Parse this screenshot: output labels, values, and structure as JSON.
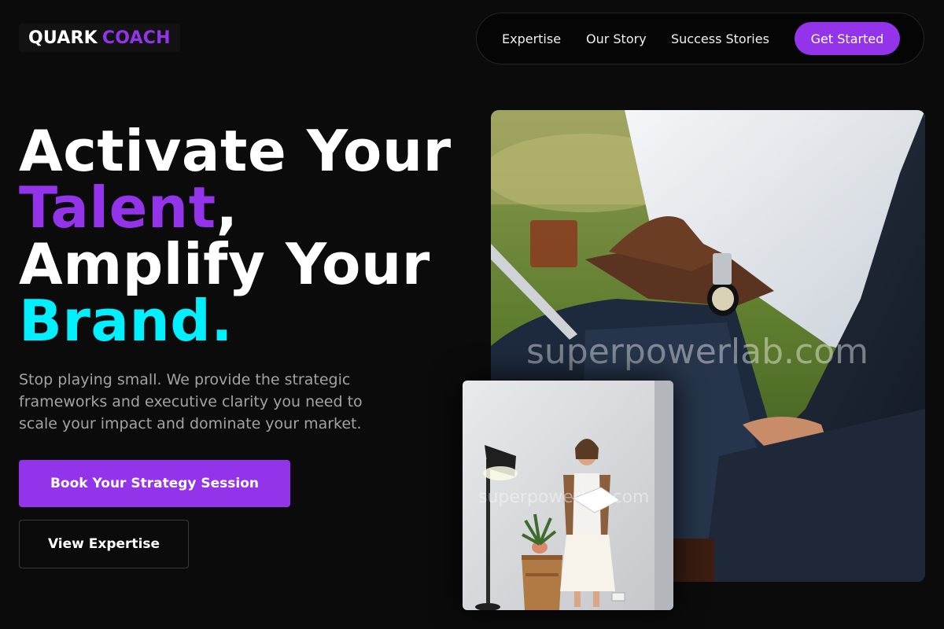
{
  "brand": {
    "word1": "QUARK",
    "word2": "COACH"
  },
  "nav": {
    "links": [
      "Expertise",
      "Our Story",
      "Success Stories"
    ],
    "cta": "Get Started"
  },
  "hero": {
    "line1": "Activate Your",
    "line2_highlight": "Talent",
    "line2_rest": ",",
    "line3": "Amplify Your",
    "line4": "Brand.",
    "subtitle": "Stop playing small. We provide the strategic frameworks and executive clarity you need to scale your impact and dominate your market.",
    "primary_button": "Book Your Strategy Session",
    "secondary_button": "View Expertise"
  },
  "images": {
    "main_watermark": "superpowerlab.com",
    "small_watermark": "superpowerlab.com"
  },
  "colors": {
    "background": "#0b0b0b",
    "accent_purple": "#9333ea",
    "accent_cyan": "#00f0ff",
    "muted_text": "#a3a3a3"
  }
}
